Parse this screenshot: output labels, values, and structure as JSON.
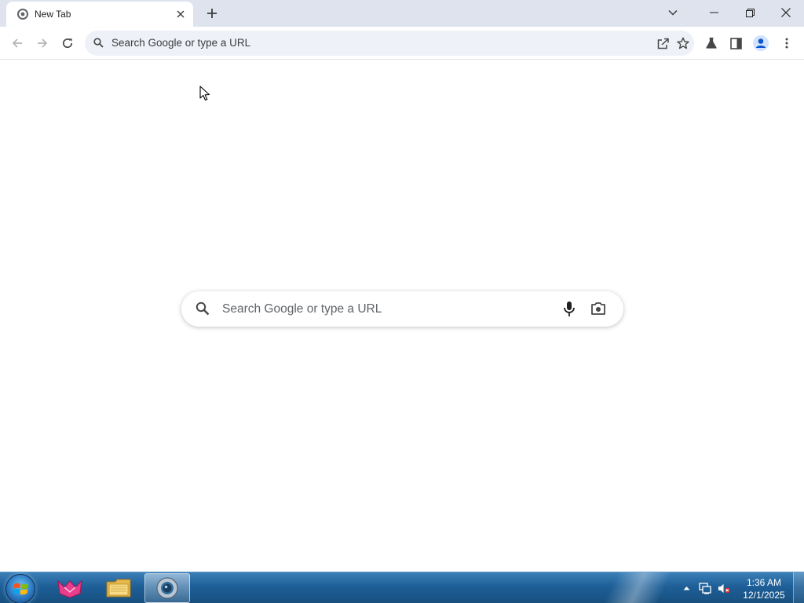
{
  "browser": {
    "tab": {
      "title": "New Tab"
    },
    "omnibox": {
      "placeholder": "Search Google or type a URL"
    }
  },
  "ntp": {
    "search_placeholder": "Search Google or type a URL"
  },
  "taskbar": {
    "clock": {
      "time": "1:36 AM",
      "date": "12/1/2025"
    },
    "apps": [
      {
        "name": "app-launcher"
      },
      {
        "name": "file-explorer"
      },
      {
        "name": "chrome",
        "active": true
      }
    ]
  },
  "colors": {
    "tabstrip": "#dee3ee",
    "omnibox_bg": "#eef1f7",
    "icon": "#474747",
    "taskbar": "#1e5f98"
  }
}
